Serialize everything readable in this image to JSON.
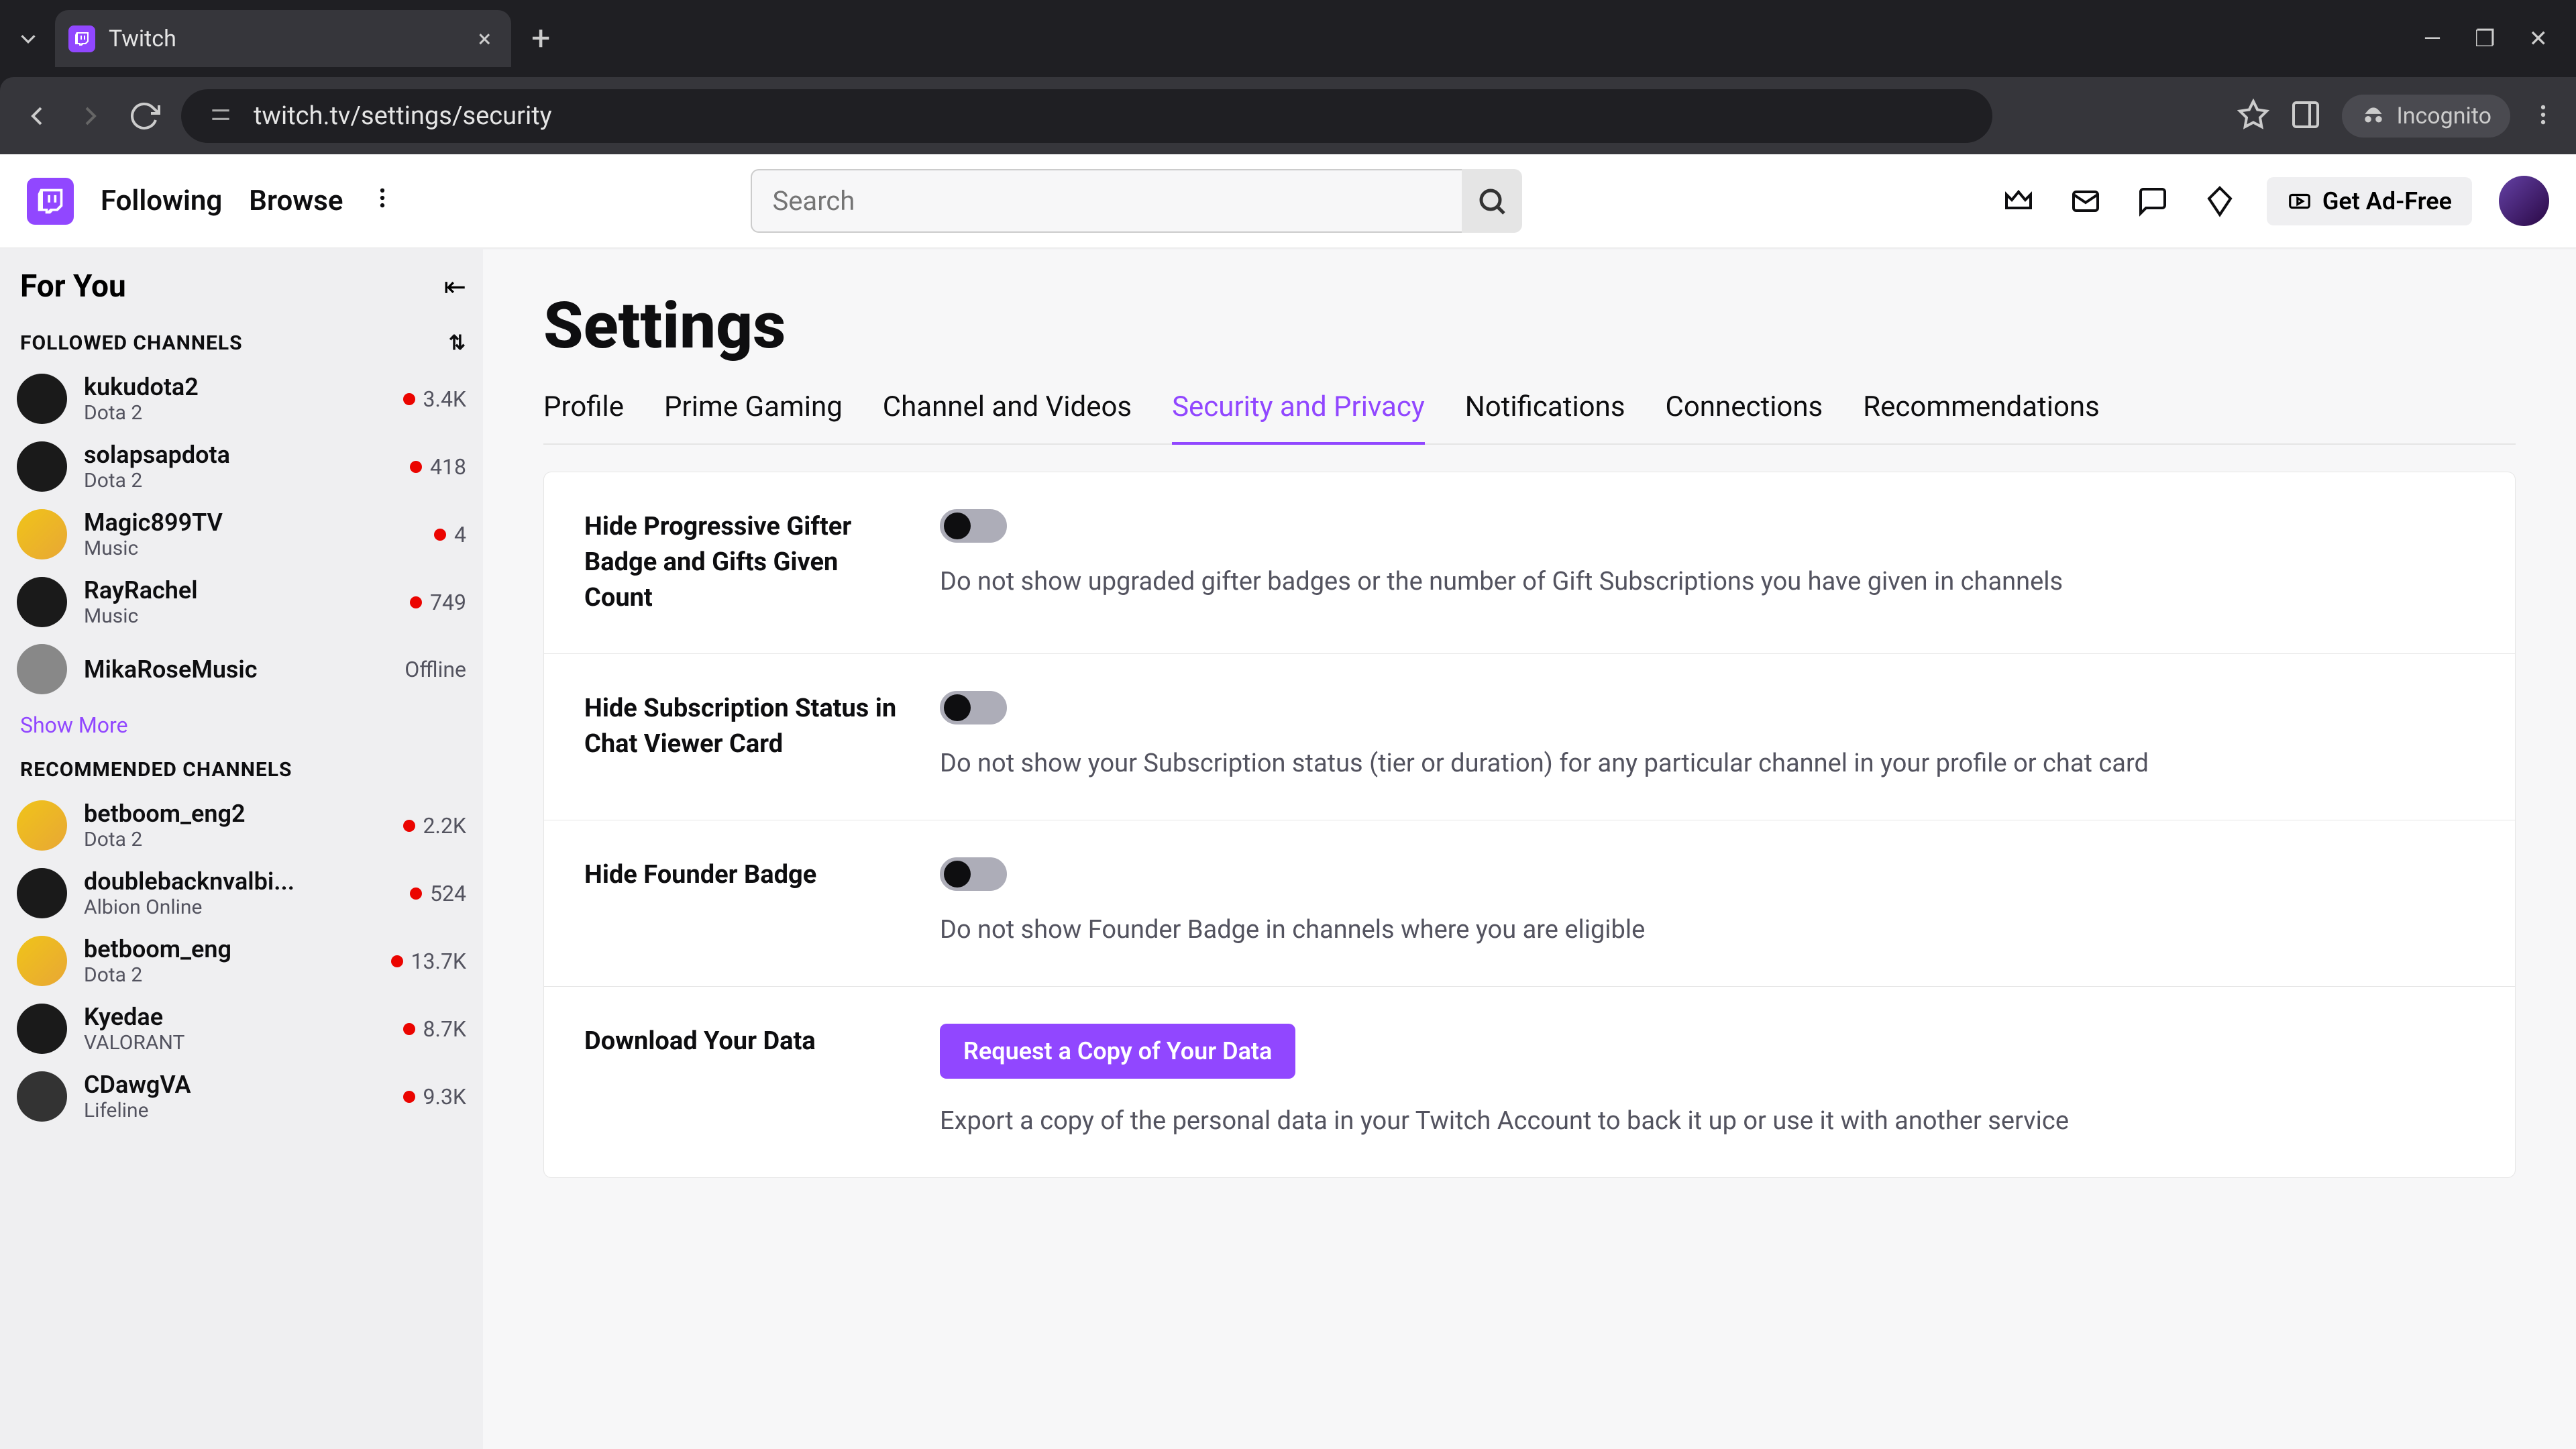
{
  "browser": {
    "tab_title": "Twitch",
    "url": "twitch.tv/settings/security",
    "incognito_label": "Incognito"
  },
  "topnav": {
    "following": "Following",
    "browse": "Browse",
    "search_placeholder": "Search",
    "ad_free": "Get Ad-Free"
  },
  "sidebar": {
    "for_you": "For You",
    "followed_header": "FOLLOWED CHANNELS",
    "recommended_header": "RECOMMENDED CHANNELS",
    "show_more": "Show More",
    "followed": [
      {
        "name": "kukudota2",
        "game": "Dota 2",
        "viewers": "3.4K",
        "live": true
      },
      {
        "name": "solapsapdota",
        "game": "Dota 2",
        "viewers": "418",
        "live": true
      },
      {
        "name": "Magic899TV",
        "game": "Music",
        "viewers": "4",
        "live": true
      },
      {
        "name": "RayRachel",
        "game": "Music",
        "viewers": "749",
        "live": true
      },
      {
        "name": "MikaRoseMusic",
        "game": "",
        "viewers": "Offline",
        "live": false
      }
    ],
    "recommended": [
      {
        "name": "betboom_eng2",
        "game": "Dota 2",
        "viewers": "2.2K",
        "live": true
      },
      {
        "name": "doublebacknvalbi...",
        "game": "Albion Online",
        "viewers": "524",
        "live": true
      },
      {
        "name": "betboom_eng",
        "game": "Dota 2",
        "viewers": "13.7K",
        "live": true
      },
      {
        "name": "Kyedae",
        "game": "VALORANT",
        "viewers": "8.7K",
        "live": true
      },
      {
        "name": "CDawgVA",
        "game": "Lifeline",
        "viewers": "9.3K",
        "live": true
      }
    ]
  },
  "settings": {
    "heading": "Settings",
    "tabs": {
      "profile": "Profile",
      "prime": "Prime Gaming",
      "channel": "Channel and Videos",
      "security": "Security and Privacy",
      "notifications": "Notifications",
      "connections": "Connections",
      "recommendations": "Recommendations"
    },
    "rows": {
      "gifter": {
        "label": "Hide Progressive Gifter Badge and Gifts Given Count",
        "desc": "Do not show upgraded gifter badges or the number of Gift Subscriptions you have given in channels"
      },
      "sub": {
        "label": "Hide Subscription Status in Chat Viewer Card",
        "desc": "Do not show your Subscription status (tier or duration) for any particular channel in your profile or chat card"
      },
      "founder": {
        "label": "Hide Founder Badge",
        "desc": "Do not show Founder Badge in channels where you are eligible"
      },
      "download": {
        "label": "Download Your Data",
        "button": "Request a Copy of Your Data",
        "desc": "Export a copy of the personal data in your Twitch Account to back it up or use it with another service"
      }
    }
  }
}
